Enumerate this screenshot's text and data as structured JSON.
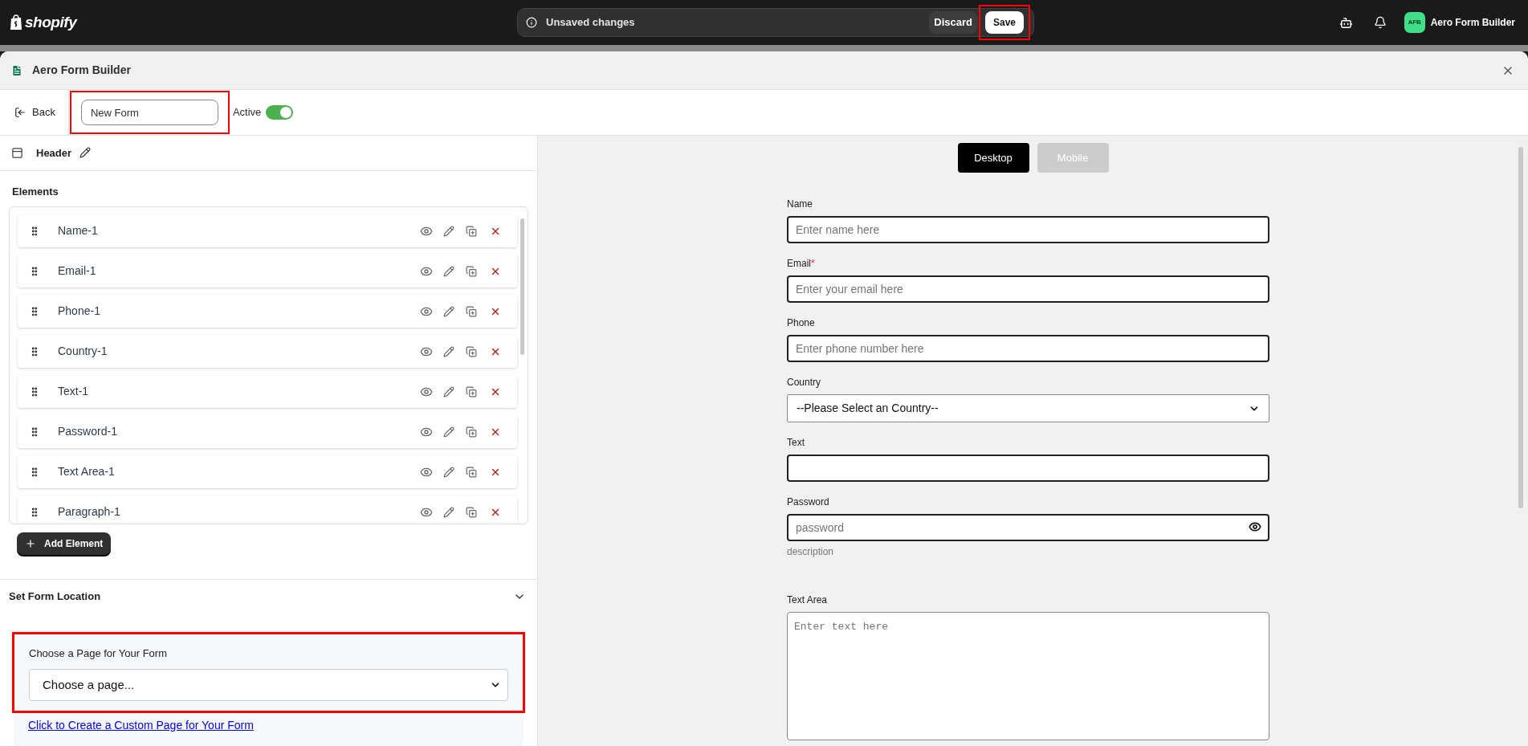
{
  "top_bar": {
    "logo": "shopify",
    "save_bar": {
      "message": "Unsaved changes",
      "discard": "Discard",
      "save": {
        "label": "Save",
        "highlighted": true
      }
    },
    "store": {
      "initials": "AFB",
      "name": "Aero Form Builder"
    }
  },
  "window": {
    "title": "Aero Form Builder"
  },
  "toolbar": {
    "back": "Back",
    "form_name": {
      "value": "New Form",
      "highlighted": true
    },
    "active": {
      "label": "Active",
      "on": true
    }
  },
  "sidebar": {
    "header": "Header",
    "elements_title": "Elements",
    "elements": [
      {
        "name": "Name-1"
      },
      {
        "name": "Email-1"
      },
      {
        "name": "Phone-1"
      },
      {
        "name": "Country-1"
      },
      {
        "name": "Text-1"
      },
      {
        "name": "Password-1"
      },
      {
        "name": "Text Area-1"
      },
      {
        "name": "Paragraph-1"
      }
    ],
    "add_button": "Add Element",
    "location": {
      "title": "Set Form Location",
      "expanded": true,
      "chooser_label": "Choose a Page for Your Form",
      "chooser_value": "Choose a page...",
      "highlighted": true,
      "link": "Click to Create a Custom Page for Your Form"
    }
  },
  "preview": {
    "tabs": [
      {
        "label": "Desktop",
        "selected": true
      },
      {
        "label": "Mobile",
        "selected": false
      }
    ],
    "fields": [
      {
        "kind": "input",
        "label": "Name",
        "placeholder": "Enter name here"
      },
      {
        "kind": "input",
        "label": "Email",
        "required_mark": "*",
        "placeholder": "Enter your email here"
      },
      {
        "kind": "input",
        "label": "Phone",
        "placeholder": "Enter phone number here"
      },
      {
        "kind": "select",
        "label": "Country",
        "value": "--Please Select an Country--"
      },
      {
        "kind": "input",
        "label": "Text"
      },
      {
        "kind": "password",
        "label": "Password",
        "placeholder": "password",
        "description": "description"
      },
      {
        "kind": "textarea",
        "label": "Text Area",
        "placeholder": "Enter text here"
      }
    ]
  }
}
